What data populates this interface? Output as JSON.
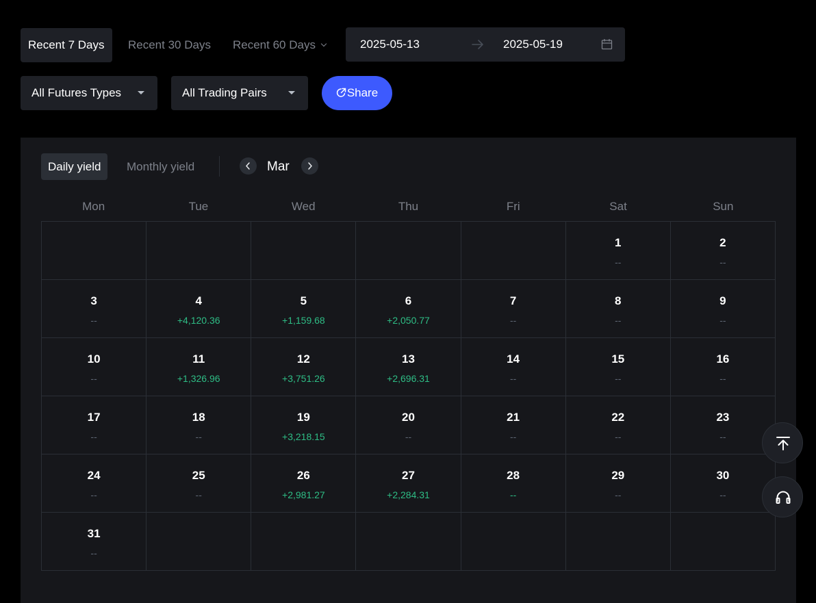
{
  "filters": {
    "ranges": [
      {
        "label": "Recent 7 Days",
        "active": true
      },
      {
        "label": "Recent 30 Days",
        "active": false
      },
      {
        "label": "Recent 60 Days",
        "active": false
      }
    ],
    "date_start": "2025-05-13",
    "date_end": "2025-05-19",
    "futures_type": "All Futures Types",
    "trading_pairs": "All Trading Pairs",
    "share_label": "Share"
  },
  "calendar": {
    "tabs": [
      {
        "label": "Daily yield",
        "active": true
      },
      {
        "label": "Monthly yield",
        "active": false
      }
    ],
    "month": "Mar",
    "weekdays": [
      "Mon",
      "Tue",
      "Wed",
      "Thu",
      "Fri",
      "Sat",
      "Sun"
    ],
    "leading_blank_cells": 5,
    "days": [
      {
        "day": "1",
        "value": "--",
        "positive": false
      },
      {
        "day": "2",
        "value": "--",
        "positive": false
      },
      {
        "day": "3",
        "value": "--",
        "positive": false
      },
      {
        "day": "4",
        "value": "+4,120.36",
        "positive": true
      },
      {
        "day": "5",
        "value": "+1,159.68",
        "positive": true
      },
      {
        "day": "6",
        "value": "+2,050.77",
        "positive": true
      },
      {
        "day": "7",
        "value": "--",
        "positive": false
      },
      {
        "day": "8",
        "value": "--",
        "positive": false
      },
      {
        "day": "9",
        "value": "--",
        "positive": false
      },
      {
        "day": "10",
        "value": "--",
        "positive": false
      },
      {
        "day": "11",
        "value": "+1,326.96",
        "positive": true
      },
      {
        "day": "12",
        "value": "+3,751.26",
        "positive": true
      },
      {
        "day": "13",
        "value": "+2,696.31",
        "positive": true
      },
      {
        "day": "14",
        "value": "--",
        "positive": false
      },
      {
        "day": "15",
        "value": "--",
        "positive": false
      },
      {
        "day": "16",
        "value": "--",
        "positive": false
      },
      {
        "day": "17",
        "value": "--",
        "positive": false
      },
      {
        "day": "18",
        "value": "--",
        "positive": false
      },
      {
        "day": "19",
        "value": "+3,218.15",
        "positive": true
      },
      {
        "day": "20",
        "value": "--",
        "positive": false
      },
      {
        "day": "21",
        "value": "--",
        "positive": false
      },
      {
        "day": "22",
        "value": "--",
        "positive": false
      },
      {
        "day": "23",
        "value": "--",
        "positive": false
      },
      {
        "day": "24",
        "value": "--",
        "positive": false
      },
      {
        "day": "25",
        "value": "--",
        "positive": false
      },
      {
        "day": "26",
        "value": "+2,981.27",
        "positive": true
      },
      {
        "day": "27",
        "value": "+2,284.31",
        "positive": true
      },
      {
        "day": "28",
        "value": "--",
        "positive": true
      },
      {
        "day": "29",
        "value": "--",
        "positive": false
      },
      {
        "day": "30",
        "value": "--",
        "positive": false
      },
      {
        "day": "31",
        "value": "--",
        "positive": false
      }
    ],
    "trailing_blank_cells": 6
  },
  "floating": {
    "icons": [
      "arrow-up-to-top-icon",
      "headset-icon"
    ]
  },
  "colors": {
    "background": "#000000",
    "panel": "#16171b",
    "control": "#1e2026",
    "accent": "#3d5afe",
    "positive": "#2ebd85",
    "muted": "#7d818a"
  }
}
